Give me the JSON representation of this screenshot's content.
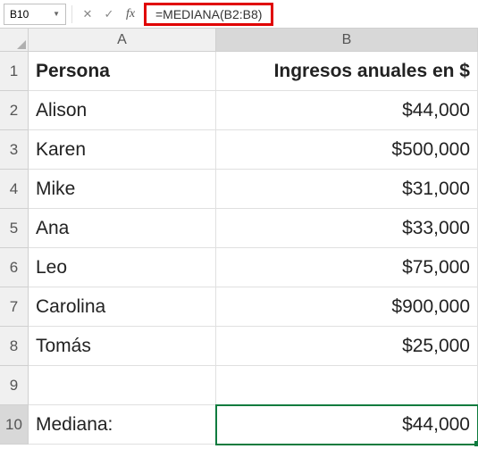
{
  "namebox": "B10",
  "formula": "=MEDIANA(B2:B8)",
  "cols": [
    "A",
    "B"
  ],
  "headers": {
    "a": "Persona",
    "b": "Ingresos anuales en $"
  },
  "rows": [
    {
      "n": "1"
    },
    {
      "n": "2",
      "a": "Alison",
      "b": "$44,000"
    },
    {
      "n": "3",
      "a": "Karen",
      "b": "$500,000"
    },
    {
      "n": "4",
      "a": "Mike",
      "b": "$31,000"
    },
    {
      "n": "5",
      "a": "Ana",
      "b": "$33,000"
    },
    {
      "n": "6",
      "a": "Leo",
      "b": "$75,000"
    },
    {
      "n": "7",
      "a": "Carolina",
      "b": "$900,000"
    },
    {
      "n": "8",
      "a": "Tomás",
      "b": "$25,000"
    },
    {
      "n": "9",
      "a": "",
      "b": ""
    },
    {
      "n": "10",
      "a": "Mediana:",
      "b": "$44,000"
    }
  ],
  "chart_data": {
    "type": "table",
    "title": "Ingresos anuales en $",
    "categories": [
      "Alison",
      "Karen",
      "Mike",
      "Ana",
      "Leo",
      "Carolina",
      "Tomás"
    ],
    "values": [
      44000,
      500000,
      31000,
      33000,
      75000,
      900000,
      25000
    ],
    "median": 44000
  }
}
